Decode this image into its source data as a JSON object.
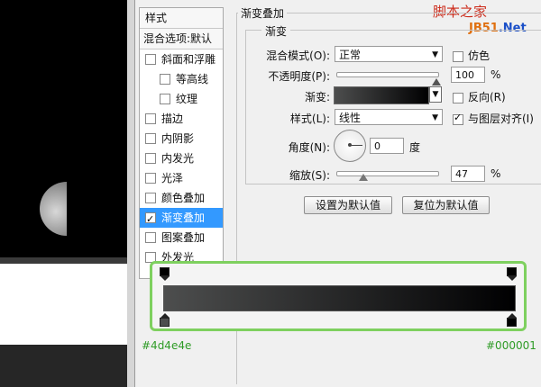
{
  "watermark": {
    "line1": "脚本之家",
    "line2_a": "JB51",
    "line2_b": ".Net"
  },
  "style_list": {
    "header": "样式",
    "blending": "混合选项:默认",
    "items": [
      {
        "label": "斜面和浮雕",
        "checked": false,
        "sub": false
      },
      {
        "label": "等高线",
        "checked": false,
        "sub": true
      },
      {
        "label": "纹理",
        "checked": false,
        "sub": true
      },
      {
        "label": "描边",
        "checked": false,
        "sub": false
      },
      {
        "label": "内阴影",
        "checked": false,
        "sub": false
      },
      {
        "label": "内发光",
        "checked": false,
        "sub": false
      },
      {
        "label": "光泽",
        "checked": false,
        "sub": false
      },
      {
        "label": "颜色叠加",
        "checked": false,
        "sub": false
      },
      {
        "label": "渐变叠加",
        "checked": true,
        "sub": false,
        "selected": true
      },
      {
        "label": "图案叠加",
        "checked": false,
        "sub": false
      },
      {
        "label": "外发光",
        "checked": false,
        "sub": false
      }
    ]
  },
  "panel": {
    "title": "渐变叠加",
    "section": "渐变",
    "blend_mode_label": "混合模式(O):",
    "blend_mode_value": "正常",
    "dither_label": "仿色",
    "opacity_label": "不透明度(P):",
    "opacity_value": "100",
    "opacity_fraction": 1.0,
    "percent": "%",
    "gradient_label": "渐变:",
    "reverse_label": "反向(R)",
    "style_label": "样式(L):",
    "style_value": "线性",
    "align_label": "与图层对齐(I)",
    "angle_label": "角度(N):",
    "angle_value": "0",
    "degree": "度",
    "scale_label": "缩放(S):",
    "scale_value": "47",
    "scale_fraction": 0.27,
    "btn_default": "设置为默认值",
    "btn_reset": "复位为默认值"
  },
  "editor": {
    "start_color": "#4d4e4e",
    "end_color": "#000001"
  },
  "colors": {
    "highlight": "#7ed05f",
    "hex_text": "#2e9b26",
    "selected_row": "#3399ff"
  }
}
